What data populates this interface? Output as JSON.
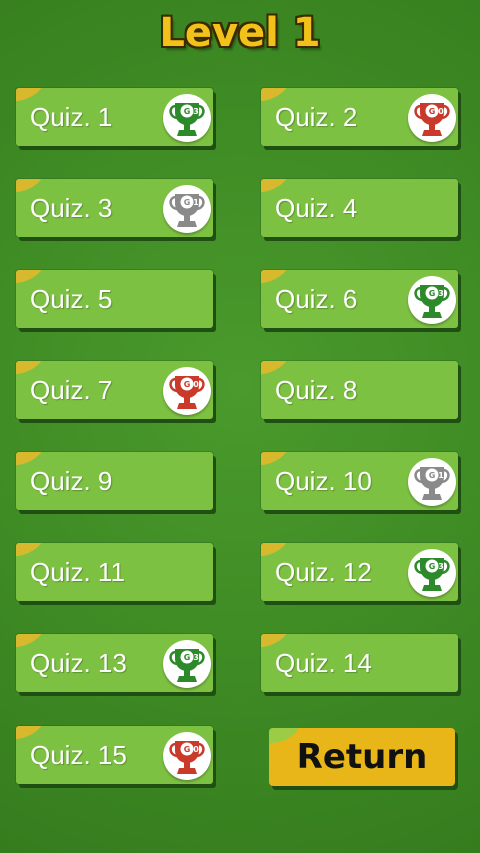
{
  "header": {
    "title": "Level 1"
  },
  "quizzes": [
    {
      "label": "Quiz. 1",
      "trophy": "green",
      "score": "3"
    },
    {
      "label": "Quiz. 2",
      "trophy": "red",
      "score": "0"
    },
    {
      "label": "Quiz. 3",
      "trophy": "gray",
      "score": "1"
    },
    {
      "label": "Quiz. 4",
      "trophy": null,
      "score": null
    },
    {
      "label": "Quiz. 5",
      "trophy": null,
      "score": null
    },
    {
      "label": "Quiz. 6",
      "trophy": "green",
      "score": "3"
    },
    {
      "label": "Quiz. 7",
      "trophy": "red",
      "score": "0"
    },
    {
      "label": "Quiz. 8",
      "trophy": null,
      "score": null
    },
    {
      "label": "Quiz. 9",
      "trophy": null,
      "score": null
    },
    {
      "label": "Quiz. 10",
      "trophy": "gray",
      "score": "1"
    },
    {
      "label": "Quiz. 11",
      "trophy": null,
      "score": null
    },
    {
      "label": "Quiz. 12",
      "trophy": "green",
      "score": "3"
    },
    {
      "label": "Quiz. 13",
      "trophy": "green",
      "score": "3"
    },
    {
      "label": "Quiz. 14",
      "trophy": null,
      "score": null
    },
    {
      "label": "Quiz. 15",
      "trophy": "red",
      "score": "0"
    }
  ],
  "return_button": {
    "label": "Return"
  },
  "colors": {
    "green_trophy": "#2d8a2a",
    "red_trophy": "#c93a2a",
    "gray_trophy": "#8a8a8a",
    "tile": "#7dc142",
    "title": "#f2c21b"
  }
}
